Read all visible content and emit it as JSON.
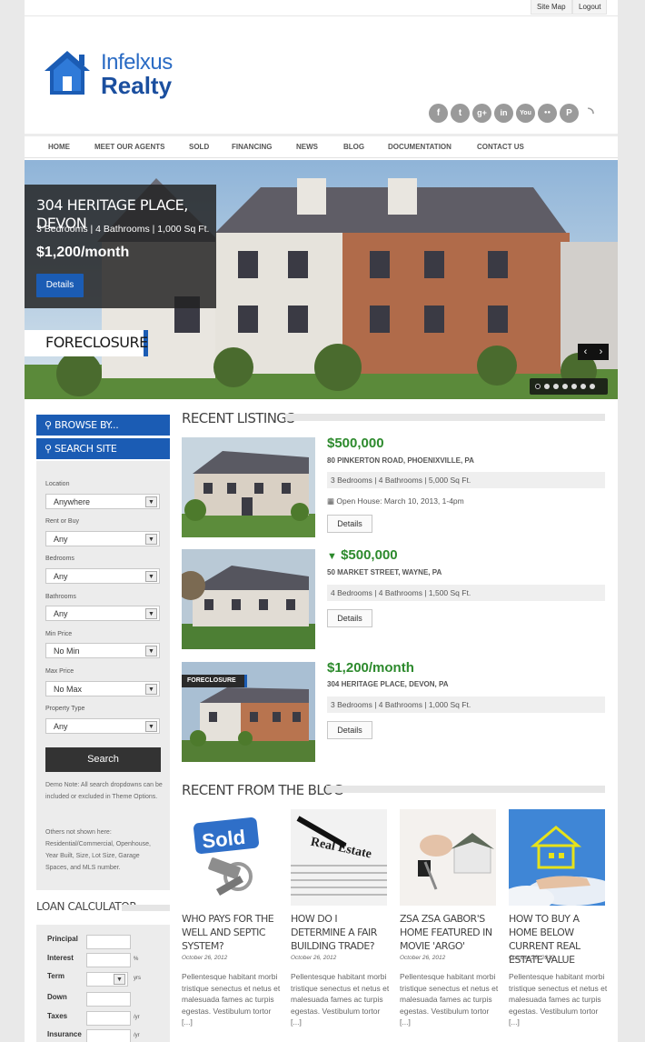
{
  "top_links": {
    "sitemap": "Site Map",
    "logout": "Logout"
  },
  "brand": {
    "name_top": "Infelxus",
    "name_bottom": "Realty",
    "colors": {
      "primary": "#1b5cb4",
      "price_green": "#2d8a2d"
    }
  },
  "socials": [
    {
      "icon": "facebook-icon",
      "glyph": "f"
    },
    {
      "icon": "twitter-icon",
      "glyph": "t"
    },
    {
      "icon": "googleplus-icon",
      "glyph": "g+"
    },
    {
      "icon": "linkedin-icon",
      "glyph": "in"
    },
    {
      "icon": "youtube-icon",
      "glyph": "You"
    },
    {
      "icon": "flickr-icon",
      "glyph": "●●"
    },
    {
      "icon": "pinterest-icon",
      "glyph": "P"
    },
    {
      "icon": "rss-icon",
      "glyph": "◝"
    }
  ],
  "nav": [
    "HOME",
    "MEET OUR AGENTS",
    "SOLD",
    "FINANCING",
    "NEWS",
    "BLOG",
    "DOCUMENTATION",
    "CONTACT US"
  ],
  "hero": {
    "address": "304 HERITAGE PLACE, DEVON",
    "specs": "3 Bedrooms | 4 Bathrooms | 1,000 Sq Ft.",
    "price": "$1,200/month",
    "button": "Details",
    "tag": "FORECLOSURE",
    "prev": "‹",
    "next": "›"
  },
  "sidebar": {
    "browse": "BROWSE BY...",
    "search": "SEARCH SITE",
    "fields": [
      {
        "label": "Location",
        "value": "Anywhere"
      },
      {
        "label": "Rent or Buy",
        "value": "Any"
      },
      {
        "label": "Bedrooms",
        "value": "Any"
      },
      {
        "label": "Bathrooms",
        "value": "Any"
      },
      {
        "label": "Min Price",
        "value": "No Min"
      },
      {
        "label": "Max Price",
        "value": "No Max"
      },
      {
        "label": "Property Type",
        "value": "Any"
      }
    ],
    "search_button": "Search",
    "note1": "Demo Note: All search dropdowns can be included or excluded in Theme Options.",
    "note2": "Others not shown here: Residential/Commercial, Openhouse, Year Built, Size, Lot Size, Garage Spaces, and MLS number."
  },
  "loan": {
    "title": "LOAN CALCULATOR",
    "fields": [
      {
        "label": "Principal",
        "unit": ""
      },
      {
        "label": "Interest",
        "unit": "%"
      },
      {
        "label": "Term",
        "unit": "yrs"
      },
      {
        "label": "Down",
        "unit": ""
      },
      {
        "label": "Taxes",
        "unit": "/yr"
      },
      {
        "label": "Insurance",
        "unit": "/yr"
      }
    ]
  },
  "listings": {
    "title": "RECENT LISTINGS",
    "items": [
      {
        "price": "$500,000",
        "address": "80 PINKERTON ROAD, PHOENIXVILLE, PA",
        "specs": "3 Bedrooms | 4 Bathrooms | 5,000 Sq Ft.",
        "open_house": "Open House: March 10, 2013, 1-4pm",
        "button": "Details"
      },
      {
        "price": "$500,000",
        "address": "50 MARKET STREET, WAYNE, PA",
        "specs": "4 Bedrooms | 4 Bathrooms | 1,500 Sq Ft.",
        "button": "Details"
      },
      {
        "price": "$1,200/month",
        "address": "304 HERITAGE PLACE, DEVON, PA",
        "specs": "3 Bedrooms | 4 Bathrooms | 1,000 Sq Ft.",
        "button": "Details",
        "badge": "FORECLOSURE"
      }
    ]
  },
  "blog": {
    "title": "RECENT FROM THE BLOG",
    "posts": [
      {
        "title": "WHO PAYS FOR THE WELL AND SEPTIC SYSTEM?",
        "date": "October 26, 2012",
        "excerpt": "Pellentesque habitant morbi tristique senectus et netus et malesuada fames ac turpis egestas. Vestibulum tortor [...]",
        "thumb_text": "Sold"
      },
      {
        "title": "HOW DO I DETERMINE A FAIR BUILDING TRADE?",
        "date": "October 26, 2012",
        "excerpt": "Pellentesque habitant morbi tristique senectus et netus et malesuada fames ac turpis egestas. Vestibulum tortor [...]",
        "thumb_text": "Real Estate"
      },
      {
        "title": "ZSA ZSA GABOR'S HOME FEATURED IN MOVIE 'ARGO'",
        "date": "October 26, 2012",
        "excerpt": "Pellentesque habitant morbi tristique senectus et netus et malesuada fames ac turpis egestas. Vestibulum tortor [...]"
      },
      {
        "title": "HOW TO BUY A HOME BELOW CURRENT REAL ESTATE VALUE",
        "date": "October 26, 2012",
        "excerpt": "Pellentesque habitant morbi tristique senectus et netus et malesuada fames ac turpis egestas. Vestibulum tortor [...]"
      }
    ]
  }
}
